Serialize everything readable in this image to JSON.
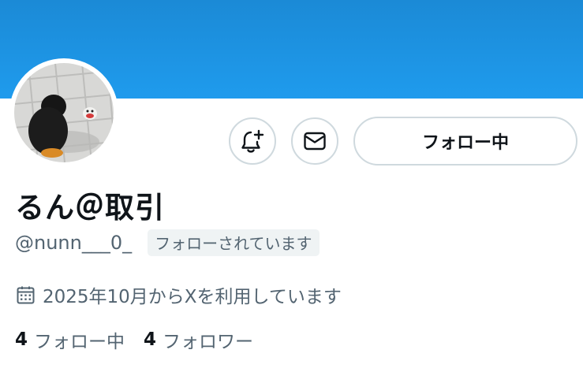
{
  "profile": {
    "display_name": "るん＠取引",
    "handle": "@nunn___0_",
    "follows_you_label": "フォローされています",
    "joined_text": "2025年10月からXを利用しています"
  },
  "actions": {
    "notify_icon": "bell-plus-icon",
    "message_icon": "mail-icon",
    "follow_button_label": "フォロー中"
  },
  "stats": {
    "following_count": "4",
    "following_label": "フォロー中",
    "followers_count": "4",
    "followers_label": "フォロワー"
  },
  "colors": {
    "banner": "#1d9bf0",
    "text_primary": "#0f1419",
    "text_secondary": "#536471",
    "border": "#cfd9de",
    "badge_bg": "#eff3f4"
  }
}
